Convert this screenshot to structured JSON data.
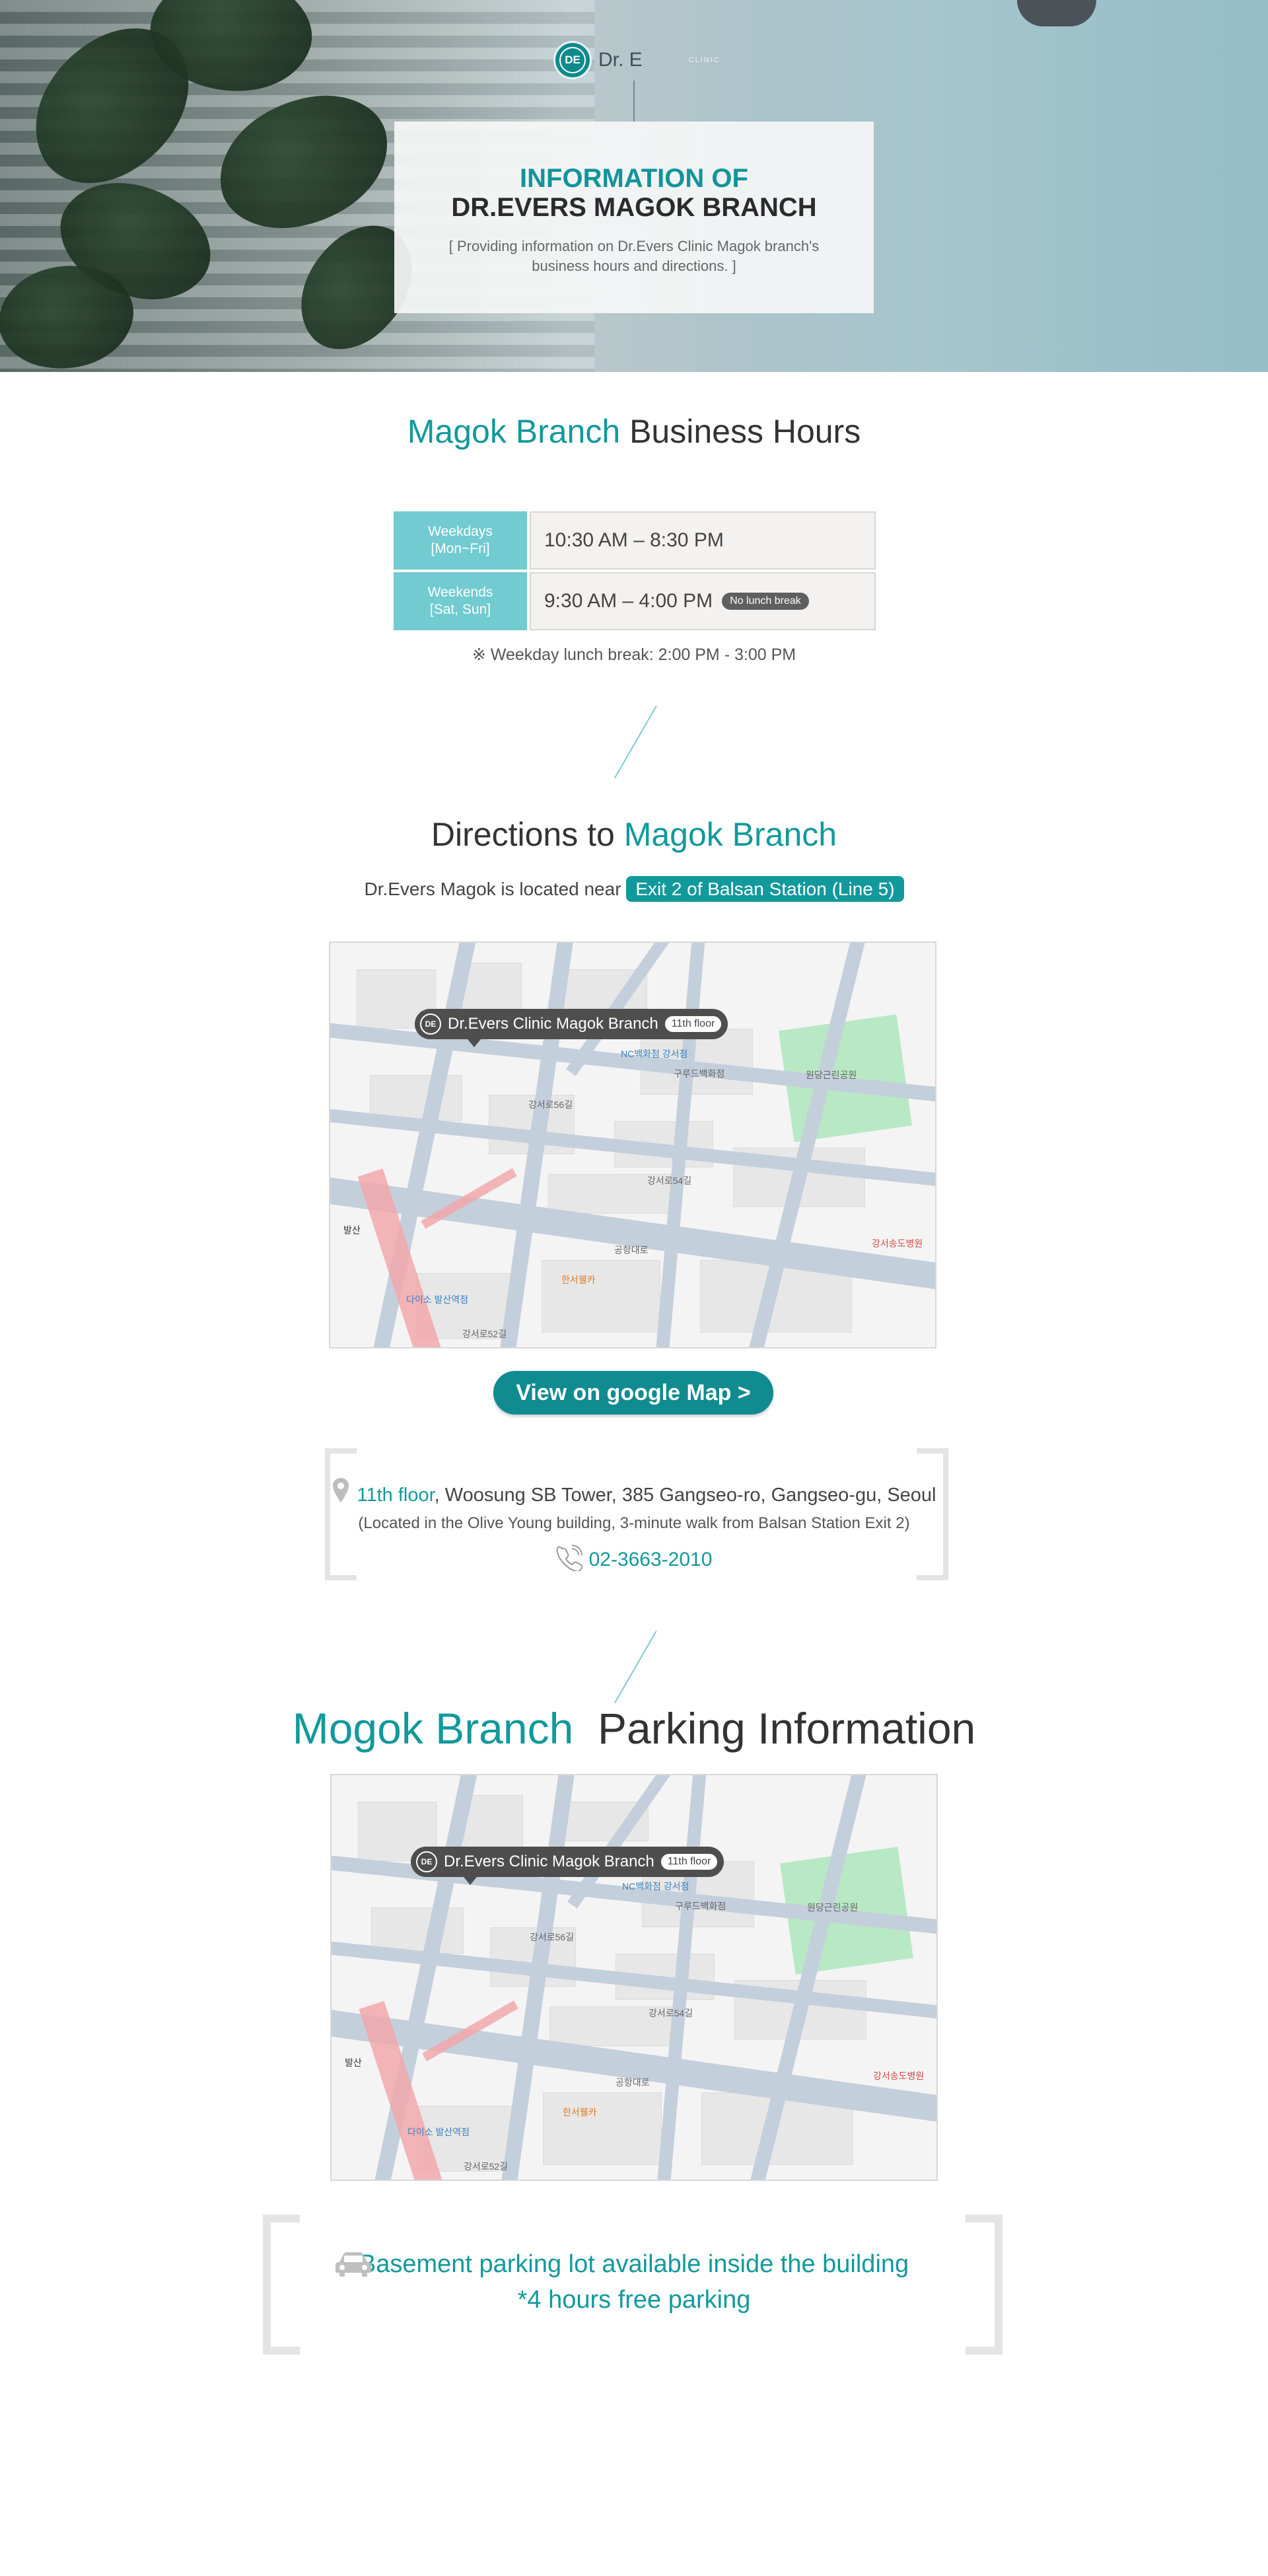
{
  "hero": {
    "logo_mark": "DE",
    "logo_text": "Dr. E",
    "logo_sub": "CLINIC",
    "title_line1": "INFORMATION OF",
    "title_line2": "DR.EVERS MAGOK BRANCH",
    "subtitle_line1": "[ Providing information on Dr.Evers Clinic Magok branch's",
    "subtitle_line2": "business hours and directions. ]"
  },
  "hours": {
    "title_accent": "Magok Branch",
    "title_rest": " Business Hours",
    "rows": [
      {
        "label_line1": "Weekdays",
        "label_line2": "[Mon~Fri]",
        "value": "10:30 AM – 8:30 PM",
        "badge": ""
      },
      {
        "label_line1": "Weekends",
        "label_line2": "[Sat, Sun]",
        "value": "9:30 AM – 4:00 PM",
        "badge": "No lunch break"
      }
    ],
    "lunch_note": "※ Weekday lunch break: 2:00 PM - 3:00 PM"
  },
  "directions": {
    "title_rest": "Directions to ",
    "title_accent": "Magok Branch",
    "note_text": "Dr.Evers Magok is located near ",
    "note_highlight": "Exit 2 of Balsan Station (Line 5)",
    "map_pin_label": "Dr.Evers Clinic Magok Branch",
    "map_pin_floor": "11th floor",
    "map_pin_logo": "DE",
    "google_button": "View on google Map >",
    "address_floor": "11th floor",
    "address_rest": ", Woosung SB Tower, 385 Gangseo-ro, Gangseo-gu, Seoul",
    "address_sub": "(Located in the Olive Young building, 3-minute walk from Balsan Station Exit 2)",
    "phone": "02-3663-2010"
  },
  "map_labels": {
    "label1": "NC백화점 강서점",
    "label2": "강서로56길",
    "label3": "강서로54길",
    "label4": "공항대로",
    "label5": "발산",
    "label6": "한서웰카",
    "label7": "다이소 발산역점",
    "label8": "원당근린공원",
    "label9": "강서송도병원",
    "label10": "구루드백화점",
    "label11": "강서로52길"
  },
  "parking": {
    "title_accent": "Mogok Branch",
    "title_rest": "  Parking Information",
    "map_pin_label": "Dr.Evers Clinic Magok Branch",
    "map_pin_floor": "11th floor",
    "map_pin_logo": "DE",
    "line1": "Basement parking lot available inside the building",
    "line2": "*4 hours free parking"
  },
  "colors": {
    "teal": "#12999c",
    "table_label": "#71cbd1",
    "button": "#108b90",
    "highlight": "#d4eff2"
  }
}
